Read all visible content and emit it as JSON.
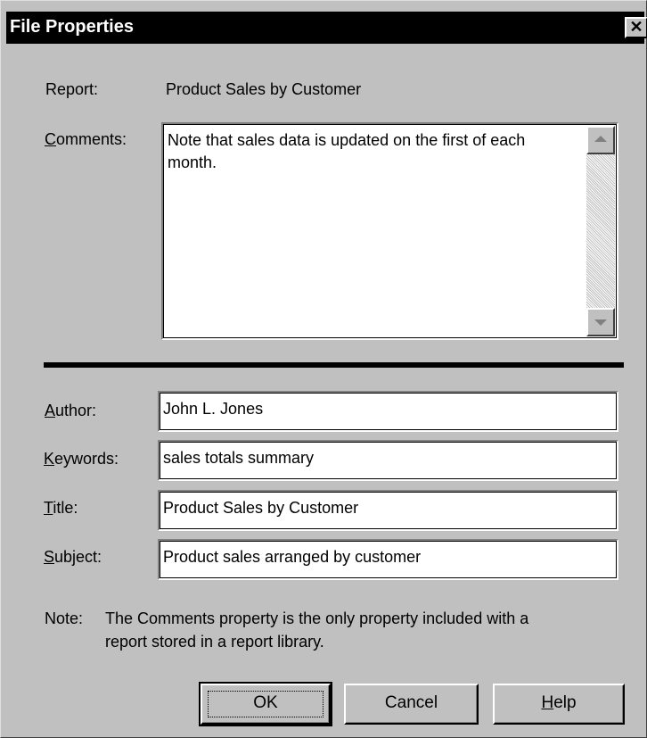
{
  "window": {
    "title": "File Properties",
    "close_glyph": "✕"
  },
  "report": {
    "label": "Report:",
    "value": "Product Sales by Customer"
  },
  "comments": {
    "label_accel": "C",
    "label_rest": "omments:",
    "value": "Note that sales data is updated on the first of each month."
  },
  "author": {
    "label_accel": "A",
    "label_rest": "uthor:",
    "value": "John L. Jones"
  },
  "keywords": {
    "label_accel": "K",
    "label_rest": "eywords:",
    "value": "sales totals summary"
  },
  "title_field": {
    "label_accel": "T",
    "label_rest": "itle:",
    "value": "Product Sales by Customer"
  },
  "subject": {
    "label_accel": "S",
    "label_rest": "ubject:",
    "value": "Product sales arranged by customer"
  },
  "note": {
    "prefix": "Note:",
    "line1": "The Comments property is the only property included with a",
    "line2": "report stored in a report library."
  },
  "buttons": {
    "ok": "OK",
    "cancel": "Cancel",
    "help_accel": "H",
    "help_rest": "elp"
  },
  "icons": {
    "close": "close-icon",
    "scroll_up": "scroll-up-arrow-icon",
    "scroll_down": "scroll-down-arrow-icon"
  },
  "colors": {
    "face": "#c0c0c0",
    "titlebar": "#000000",
    "field_bg": "#ffffff"
  }
}
